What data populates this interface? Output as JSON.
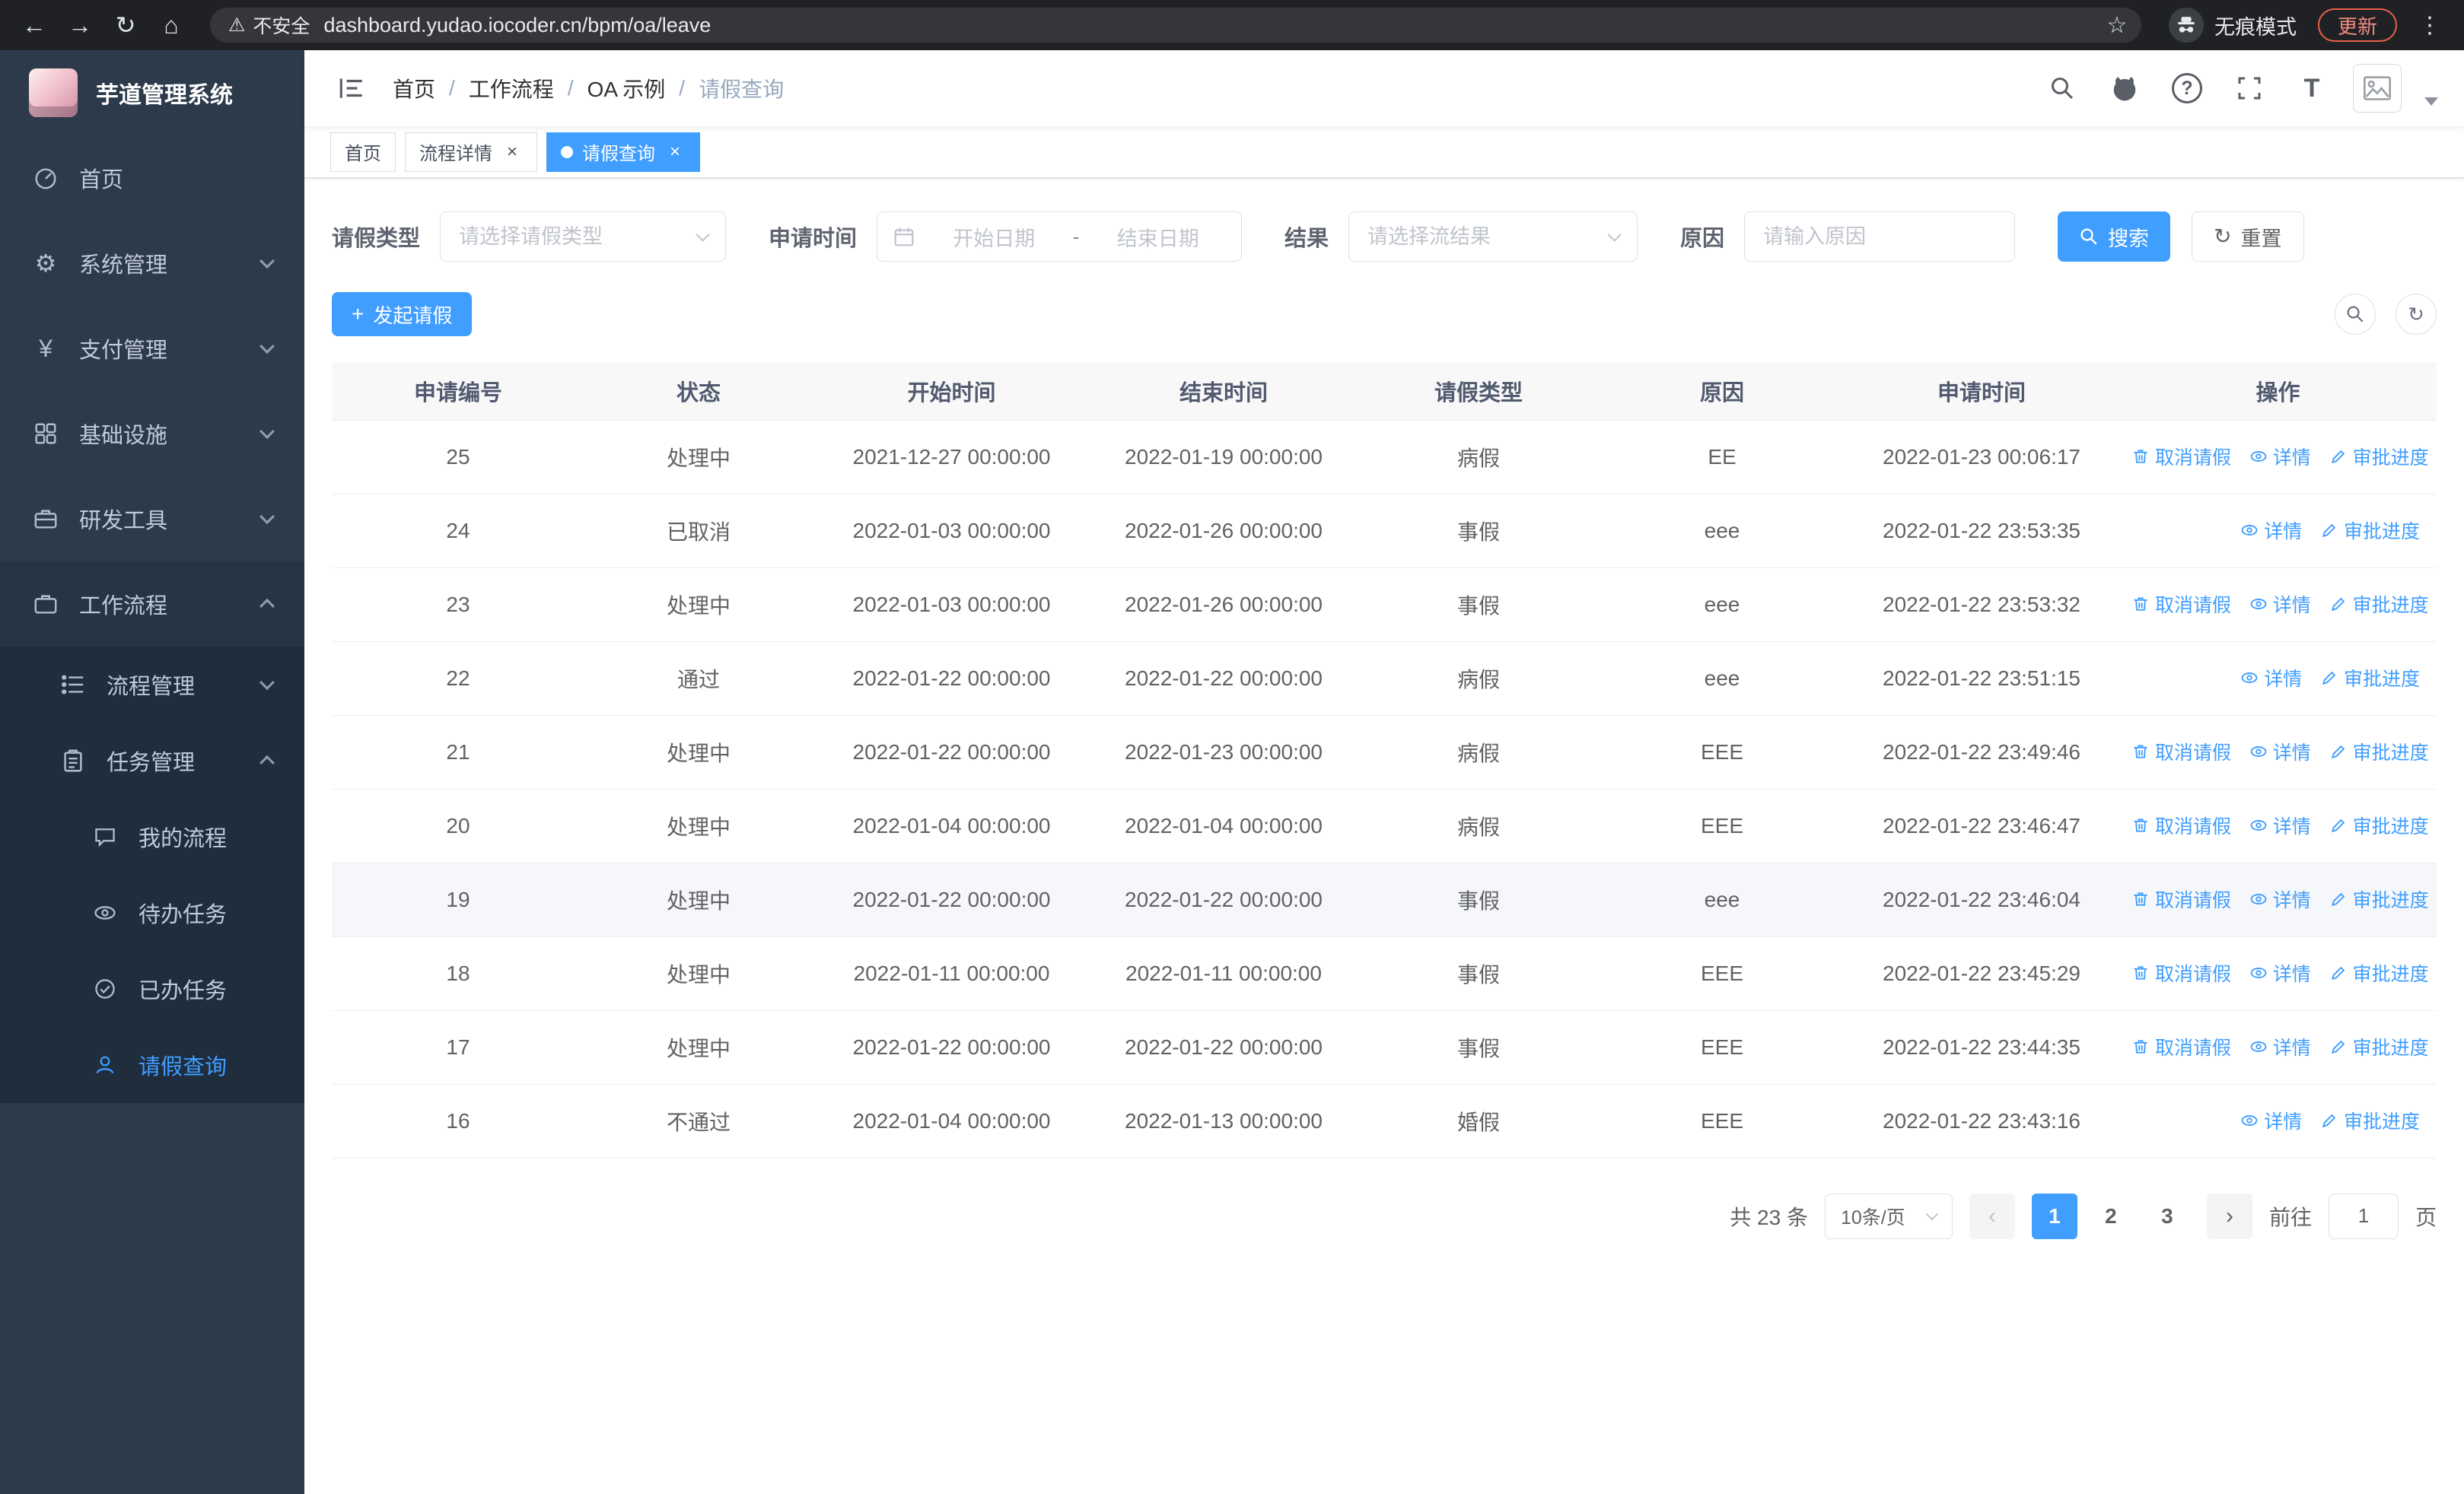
{
  "colors": {
    "primary": "#409eff",
    "sidebar_bg": "#2d3a4b",
    "sidebar_submenu_bg": "#1f2d3d",
    "active_tab_bg": "#409eff",
    "update_badge": "#e8604c",
    "table_header_bg": "#f8f8f9"
  },
  "icons": {
    "back": "←",
    "forward": "→",
    "reload": "↻",
    "home": "⌂",
    "warning": "⚠",
    "star": "☆",
    "kebab": "⋮",
    "gear": "⚙",
    "yen": "¥",
    "question": "?",
    "font_size": "T",
    "plus": "+",
    "refresh": "↻",
    "close": "×",
    "prev": "‹",
    "next": "›"
  },
  "browser": {
    "security_chip": "不安全",
    "url": "dashboard.yudao.iocoder.cn/bpm/oa/leave",
    "incognito_label": "无痕模式",
    "update_button": "更新"
  },
  "app": {
    "title": "芋道管理系统"
  },
  "sidebar": {
    "items": [
      "首页",
      "系统管理",
      "支付管理",
      "基础设施",
      "研发工具",
      "工作流程",
      "流程管理",
      "任务管理",
      "我的流程",
      "待办任务",
      "已办任务",
      "请假查询"
    ]
  },
  "breadcrumb": {
    "separator": "/",
    "items": [
      "首页",
      "工作流程",
      "OA 示例",
      "请假查询"
    ]
  },
  "tabs": [
    {
      "label": "首页",
      "closable": false,
      "active": false
    },
    {
      "label": "流程详情",
      "closable": true,
      "active": false
    },
    {
      "label": "请假查询",
      "closable": true,
      "active": true
    }
  ],
  "filters": {
    "leave_type_label": "请假类型",
    "leave_type_placeholder": "请选择请假类型",
    "apply_time_label": "申请时间",
    "start_date_placeholder": "开始日期",
    "range_separator": "-",
    "end_date_placeholder": "结束日期",
    "result_label": "结果",
    "result_placeholder": "请选择流结果",
    "reason_label": "原因",
    "reason_placeholder": "请输入原因",
    "search_button": "搜索",
    "reset_button": "重置"
  },
  "toolbar": {
    "create_button": "发起请假"
  },
  "table": {
    "columns": [
      "申请编号",
      "状态",
      "开始时间",
      "结束时间",
      "请假类型",
      "原因",
      "申请时间",
      "操作"
    ],
    "actions": {
      "cancel": "取消请假",
      "detail": "详情",
      "progress": "审批进度"
    },
    "rows": [
      {
        "id": "25",
        "status": "处理中",
        "start": "2021-12-27 00:00:00",
        "end": "2022-01-19 00:00:00",
        "type": "病假",
        "reason": "EE",
        "apply_time": "2022-01-23 00:06:17",
        "can_cancel": true,
        "hover": false
      },
      {
        "id": "24",
        "status": "已取消",
        "start": "2022-01-03 00:00:00",
        "end": "2022-01-26 00:00:00",
        "type": "事假",
        "reason": "eee",
        "apply_time": "2022-01-22 23:53:35",
        "can_cancel": false,
        "hover": false
      },
      {
        "id": "23",
        "status": "处理中",
        "start": "2022-01-03 00:00:00",
        "end": "2022-01-26 00:00:00",
        "type": "事假",
        "reason": "eee",
        "apply_time": "2022-01-22 23:53:32",
        "can_cancel": true,
        "hover": false
      },
      {
        "id": "22",
        "status": "通过",
        "start": "2022-01-22 00:00:00",
        "end": "2022-01-22 00:00:00",
        "type": "病假",
        "reason": "eee",
        "apply_time": "2022-01-22 23:51:15",
        "can_cancel": false,
        "hover": false
      },
      {
        "id": "21",
        "status": "处理中",
        "start": "2022-01-22 00:00:00",
        "end": "2022-01-23 00:00:00",
        "type": "病假",
        "reason": "EEE",
        "apply_time": "2022-01-22 23:49:46",
        "can_cancel": true,
        "hover": false
      },
      {
        "id": "20",
        "status": "处理中",
        "start": "2022-01-04 00:00:00",
        "end": "2022-01-04 00:00:00",
        "type": "病假",
        "reason": "EEE",
        "apply_time": "2022-01-22 23:46:47",
        "can_cancel": true,
        "hover": false
      },
      {
        "id": "19",
        "status": "处理中",
        "start": "2022-01-22 00:00:00",
        "end": "2022-01-22 00:00:00",
        "type": "事假",
        "reason": "eee",
        "apply_time": "2022-01-22 23:46:04",
        "can_cancel": true,
        "hover": true
      },
      {
        "id": "18",
        "status": "处理中",
        "start": "2022-01-11 00:00:00",
        "end": "2022-01-11 00:00:00",
        "type": "事假",
        "reason": "EEE",
        "apply_time": "2022-01-22 23:45:29",
        "can_cancel": true,
        "hover": false
      },
      {
        "id": "17",
        "status": "处理中",
        "start": "2022-01-22 00:00:00",
        "end": "2022-01-22 00:00:00",
        "type": "事假",
        "reason": "EEE",
        "apply_time": "2022-01-22 23:44:35",
        "can_cancel": true,
        "hover": false
      },
      {
        "id": "16",
        "status": "不通过",
        "start": "2022-01-04 00:00:00",
        "end": "2022-01-13 00:00:00",
        "type": "婚假",
        "reason": "EEE",
        "apply_time": "2022-01-22 23:43:16",
        "can_cancel": false,
        "hover": false
      }
    ]
  },
  "pagination": {
    "total": "共 23 条",
    "page_size": "10条/页",
    "pages": [
      {
        "label": "1",
        "active": true
      },
      {
        "label": "2",
        "active": false
      },
      {
        "label": "3",
        "active": false
      }
    ],
    "goto_label": "前往",
    "goto_value": "1",
    "unit_label": "页"
  }
}
